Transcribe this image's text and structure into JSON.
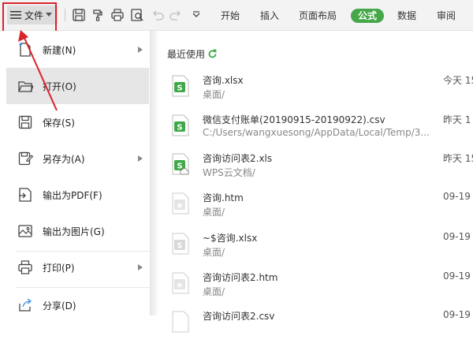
{
  "toolbar": {
    "file_label": "文件",
    "tabs": [
      {
        "label": "开始"
      },
      {
        "label": "插入"
      },
      {
        "label": "页面布局"
      },
      {
        "label": "公式",
        "active": true
      },
      {
        "label": "数据"
      },
      {
        "label": "审阅"
      }
    ],
    "active_tab_color": "#45a748",
    "highlight_color": "#d9232b",
    "icons": [
      "menu-icon",
      "save-icon",
      "format-painter-icon",
      "print-icon",
      "print-preview-icon",
      "undo-icon",
      "redo-icon",
      "more-icon"
    ]
  },
  "menu": {
    "items": [
      {
        "label": "新建(N)",
        "icon": "new-document-icon",
        "has_submenu": true
      },
      {
        "label": "打开(O)",
        "icon": "open-folder-icon",
        "has_submenu": false,
        "active": true
      },
      {
        "label": "保存(S)",
        "icon": "save-icon",
        "has_submenu": false
      },
      {
        "label": "另存为(A)",
        "icon": "save-as-icon",
        "has_submenu": true
      },
      {
        "label": "输出为PDF(F)",
        "icon": "export-pdf-icon",
        "has_submenu": false
      },
      {
        "label": "输出为图片(G)",
        "icon": "export-image-icon",
        "has_submenu": false
      },
      {
        "label": "打印(P)",
        "icon": "print-icon",
        "has_submenu": true
      },
      {
        "label": "分享(D)",
        "icon": "share-icon",
        "has_submenu": false
      }
    ]
  },
  "recent": {
    "title": "最近使用",
    "files": [
      {
        "name": "咨询.xlsx",
        "path": "桌面/",
        "time": "今天 15",
        "type": "xlsx"
      },
      {
        "name": "微信支付账单(20190915-20190922).csv",
        "path": "C:/Users/wangxuesong/AppData/Local/Temp/3...",
        "time": "昨天 1",
        "type": "csv"
      },
      {
        "name": "咨询访问表2.xls",
        "path": "WPS云文档/",
        "time": "昨天 15",
        "type": "xls-cloud"
      },
      {
        "name": "咨询.htm",
        "path": "桌面/",
        "time": "09-19",
        "type": "htm"
      },
      {
        "name": "~$咨询.xlsx",
        "path": "桌面/",
        "time": "09-19",
        "type": "xlsx-temp"
      },
      {
        "name": "咨询访问表2.htm",
        "path": "桌面/",
        "time": "09-19",
        "type": "htm"
      },
      {
        "name": "咨询访问表2.csv",
        "path": "",
        "time": "09-19",
        "type": "csv-gray"
      }
    ]
  }
}
